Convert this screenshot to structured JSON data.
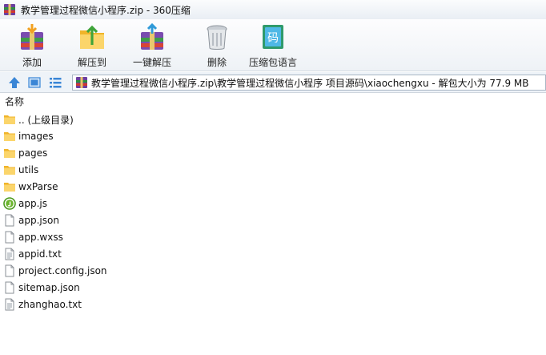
{
  "window": {
    "title": "教学管理过程微信小程序.zip - 360压缩"
  },
  "toolbar": {
    "add_label": "添加",
    "extract_to_label": "解压到",
    "one_click_extract_label": "一键解压",
    "delete_label": "删除",
    "compress_language_label": "压缩包语言"
  },
  "address": {
    "path": "教学管理过程微信小程序.zip\\教学管理过程微信小程序 项目源码\\xiaochengxu - 解包大小为 77.9 MB"
  },
  "file_list": {
    "header": "名称",
    "items": [
      {
        "name": ".. (上级目录)",
        "icon": "folder-icon"
      },
      {
        "name": "images",
        "icon": "folder-icon"
      },
      {
        "name": "pages",
        "icon": "folder-icon"
      },
      {
        "name": "utils",
        "icon": "folder-icon"
      },
      {
        "name": "wxParse",
        "icon": "folder-icon"
      },
      {
        "name": "app.js",
        "icon": "js-file-icon"
      },
      {
        "name": "app.json",
        "icon": "file-icon"
      },
      {
        "name": "app.wxss",
        "icon": "file-icon"
      },
      {
        "name": "appid.txt",
        "icon": "text-file-icon"
      },
      {
        "name": "project.config.json",
        "icon": "file-icon"
      },
      {
        "name": "sitemap.json",
        "icon": "file-icon"
      },
      {
        "name": "zhanghao.txt",
        "icon": "text-file-icon"
      }
    ]
  },
  "colors": {
    "folder": "#f5c542",
    "accent_blue": "#3a86d6",
    "js_green": "#4a9a1c"
  }
}
